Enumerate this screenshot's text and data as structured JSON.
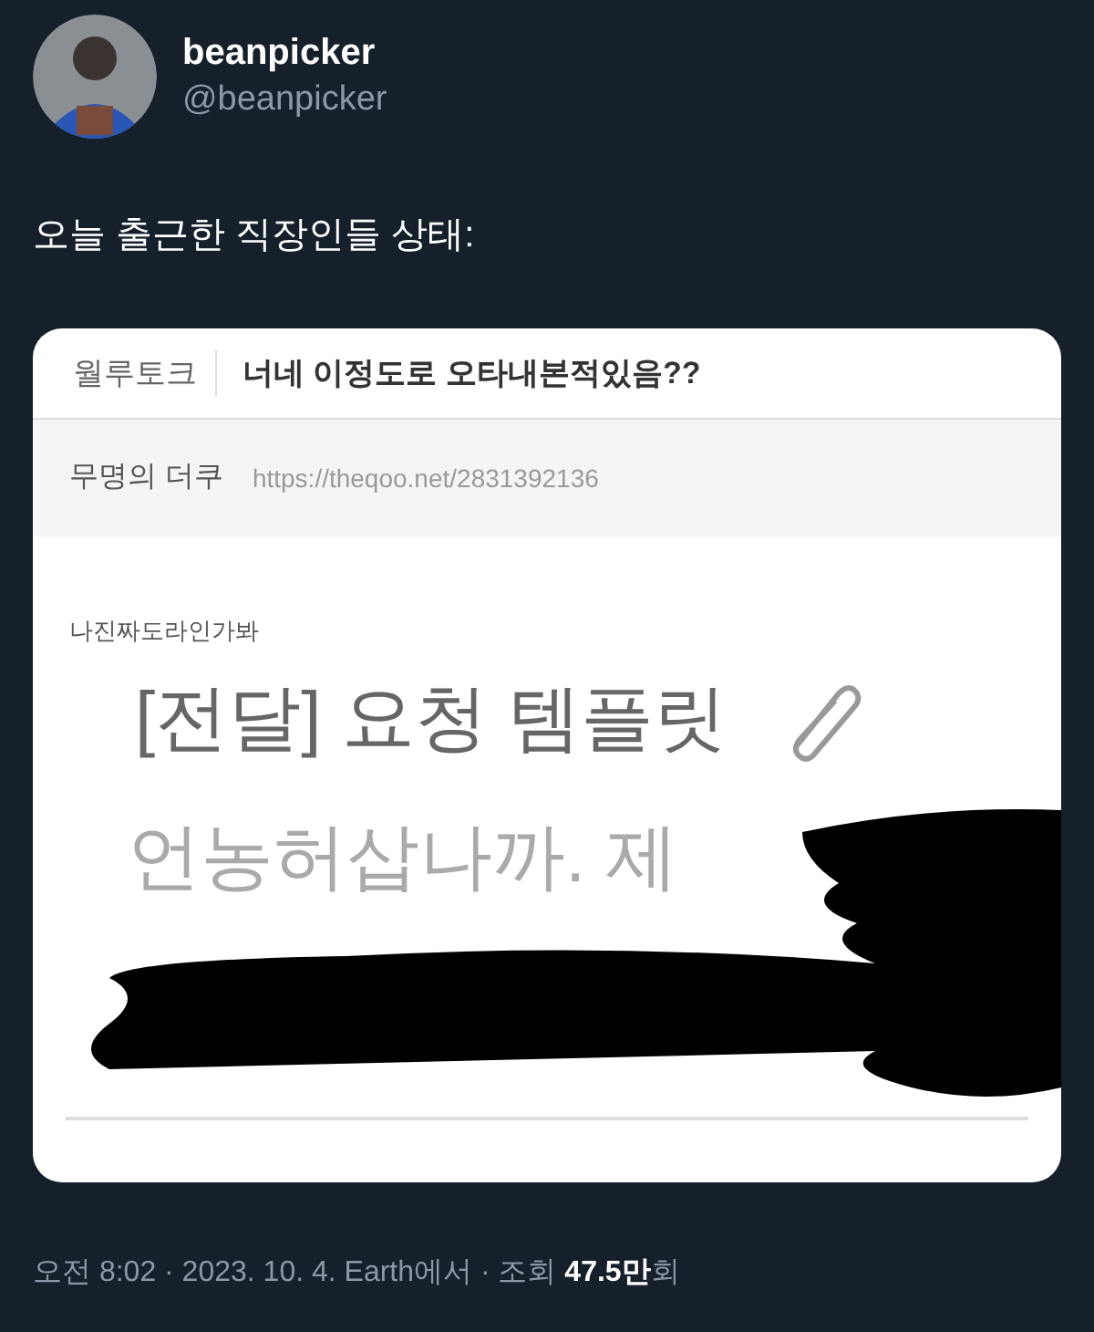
{
  "author": {
    "name": "beanpicker",
    "handle": "@beanpicker"
  },
  "tweet": {
    "text": "오늘 출근한 직장인들 상태:"
  },
  "media": {
    "board": "월루토크",
    "post_title": "너네 이정도로 오타내본적있음??",
    "poster": "무명의 더쿠",
    "url": "https://theqoo.net/2831392136",
    "caption": "나진짜도라인가봐",
    "mail_subject": "[전달] 요청 템플릿",
    "mail_preview": "언농허삽나까. 제"
  },
  "footer": {
    "meta": "오전 8:02 · 2023. 10. 4. Earth에서 · 조회 **47.5만**회"
  }
}
